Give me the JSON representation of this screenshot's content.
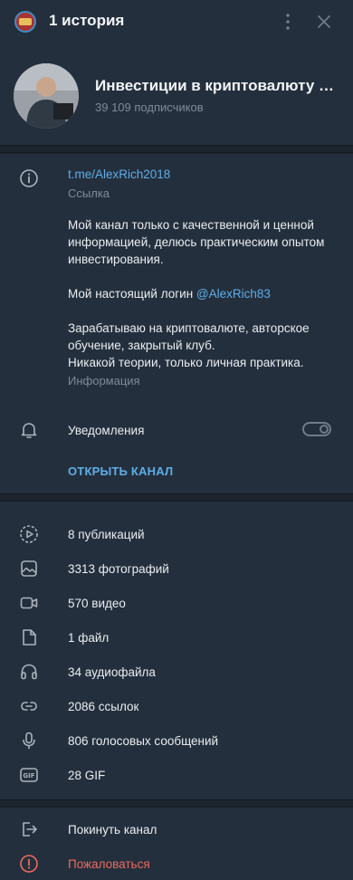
{
  "header": {
    "story_title": "1 история",
    "channel_title": "Инвестиции в криптовалюту с...",
    "subscribers": "39 109 подписчиков"
  },
  "info": {
    "link": "t.me/AlexRich2018",
    "link_caption": "Ссылка",
    "description_p1": "Мой канал только с качественной и ценной информацией, делюсь практическим опытом инвестирования.",
    "description_p2_prefix": "Мой настоящий логин ",
    "description_p2_mention": "@AlexRich83",
    "description_p3_line1": "Зарабатываю на криптовалюте, авторское обучение, закрытый клуб.",
    "description_p3_line2": "Никакой теории, только личная практика.",
    "description_caption": "Информация",
    "notifications_label": "Уведомления",
    "notifications_enabled": false,
    "open_channel": "ОТКРЫТЬ КАНАЛ"
  },
  "media": [
    {
      "icon": "stories-icon",
      "label": "8 публикаций"
    },
    {
      "icon": "photo-icon",
      "label": "3313 фотографий"
    },
    {
      "icon": "video-icon",
      "label": "570 видео"
    },
    {
      "icon": "file-icon",
      "label": "1 файл"
    },
    {
      "icon": "headphones-icon",
      "label": "34 аудиофайла"
    },
    {
      "icon": "link-icon",
      "label": "2086 ссылок"
    },
    {
      "icon": "microphone-icon",
      "label": "806 голосовых сообщений"
    },
    {
      "icon": "gif-icon",
      "label": "28 GIF"
    }
  ],
  "actions": {
    "leave": "Покинуть канал",
    "report": "Пожаловаться"
  },
  "colors": {
    "background": "#242f3d",
    "accent": "#5eaee8",
    "danger": "#ec6a5e",
    "muted": "#7f8b98"
  }
}
